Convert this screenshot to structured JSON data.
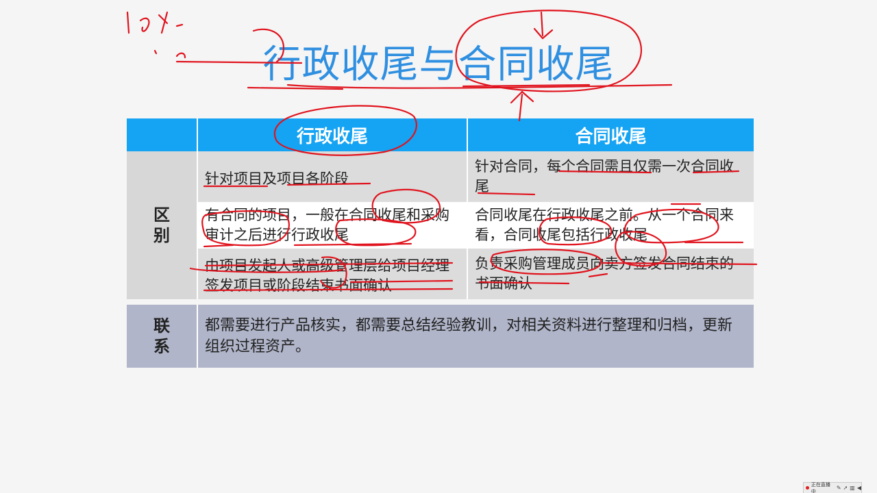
{
  "slide": {
    "title": "行政收尾与合同收尾"
  },
  "table": {
    "col_headers": [
      "",
      "行政收尾",
      "合同收尾"
    ],
    "diff_label": "区\n别",
    "diff_rows": [
      {
        "admin": "针对项目及项目各阶段",
        "contract": "针对合同，每个合同需且仅需一次合同收尾"
      },
      {
        "admin": "有合同的项目，一般在合同收尾和采购审计之后进行行政收尾",
        "contract": "合同收尾在行政收尾之前。从一个合同来看，合同收尾包括行政收尾"
      },
      {
        "admin": "由项目发起人或高级管理层给项目经理签发项目或阶段结束书面确认",
        "contract": "负责采购管理成员向卖方签发合同结束的书面确认"
      }
    ],
    "link_label": "联\n系",
    "link_text": "都需要进行产品核实，都需要总结经验教训，对相关资料进行整理和归档，更新组织过程资产。"
  },
  "status_tray": {
    "live_text": "正在直播中",
    "icons": [
      "pen-icon",
      "pointer-icon",
      "audio-icon",
      "volume-icon"
    ]
  },
  "colors": {
    "title": "#2f8fe0",
    "header_bg": "#15a3f3",
    "row_gray": "#dcdcdc",
    "link_bg": "#b0b5c9",
    "annotation": "#e0141e"
  }
}
